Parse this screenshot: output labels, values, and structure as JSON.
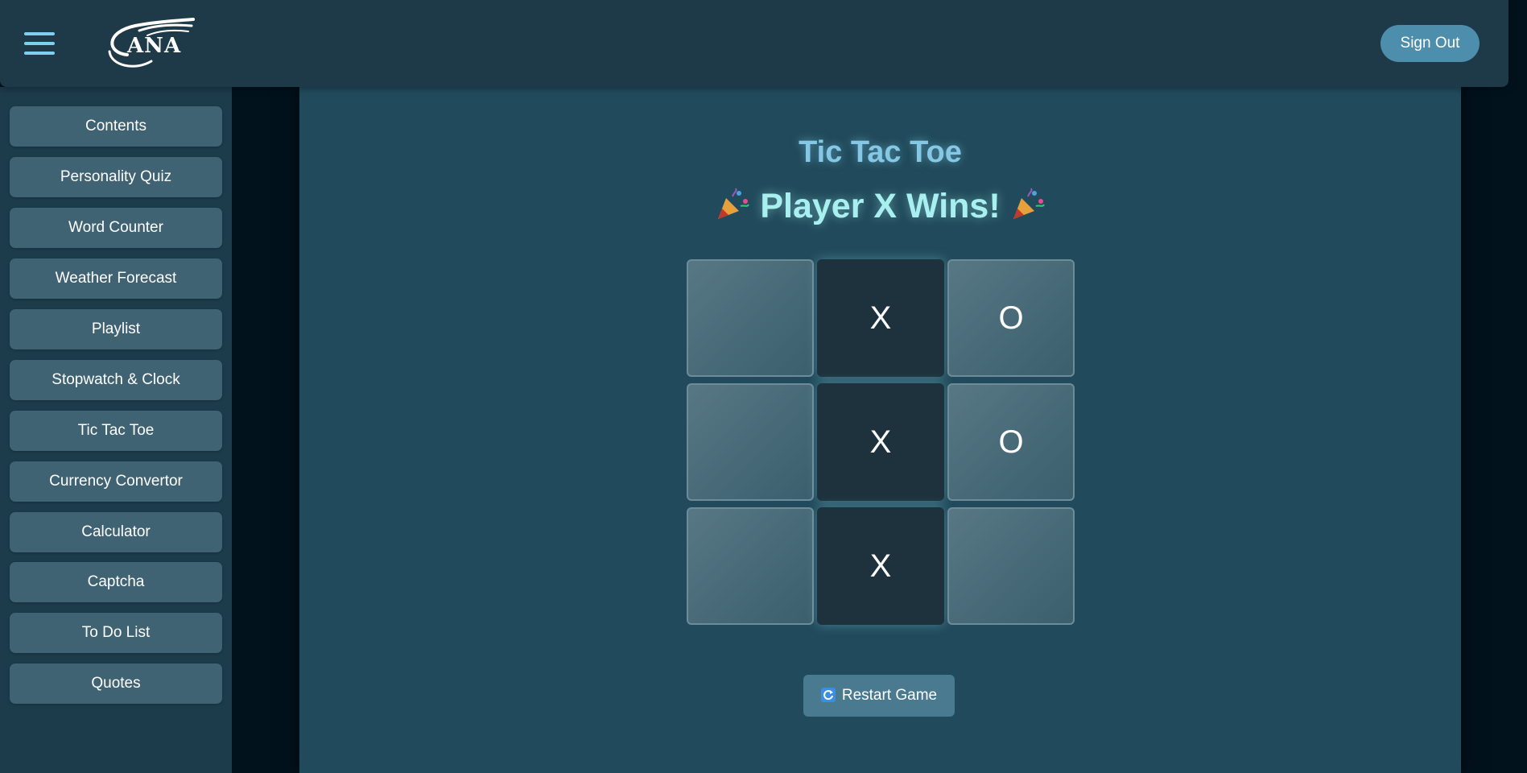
{
  "header": {
    "logo_text": "ANA",
    "signout_label": "Sign Out"
  },
  "sidebar": {
    "items": [
      {
        "label": "Contents"
      },
      {
        "label": "Personality Quiz"
      },
      {
        "label": "Word Counter"
      },
      {
        "label": "Weather Forecast"
      },
      {
        "label": "Playlist"
      },
      {
        "label": "Stopwatch & Clock"
      },
      {
        "label": "Tic Tac Toe"
      },
      {
        "label": "Currency Convertor"
      },
      {
        "label": "Calculator"
      },
      {
        "label": "Captcha"
      },
      {
        "label": "To Do List"
      },
      {
        "label": "Quotes"
      }
    ]
  },
  "game": {
    "title": "Tic Tac Toe",
    "status": "Player X Wins!",
    "board": [
      "",
      "X",
      "O",
      "",
      "X",
      "O",
      "",
      "X",
      ""
    ],
    "winning_cells": [
      1,
      4,
      7
    ],
    "restart_label": "Restart Game"
  },
  "colors": {
    "accent": "#7fd0f0",
    "signout": "#4c8eab",
    "win_cell": "#1d323c"
  }
}
